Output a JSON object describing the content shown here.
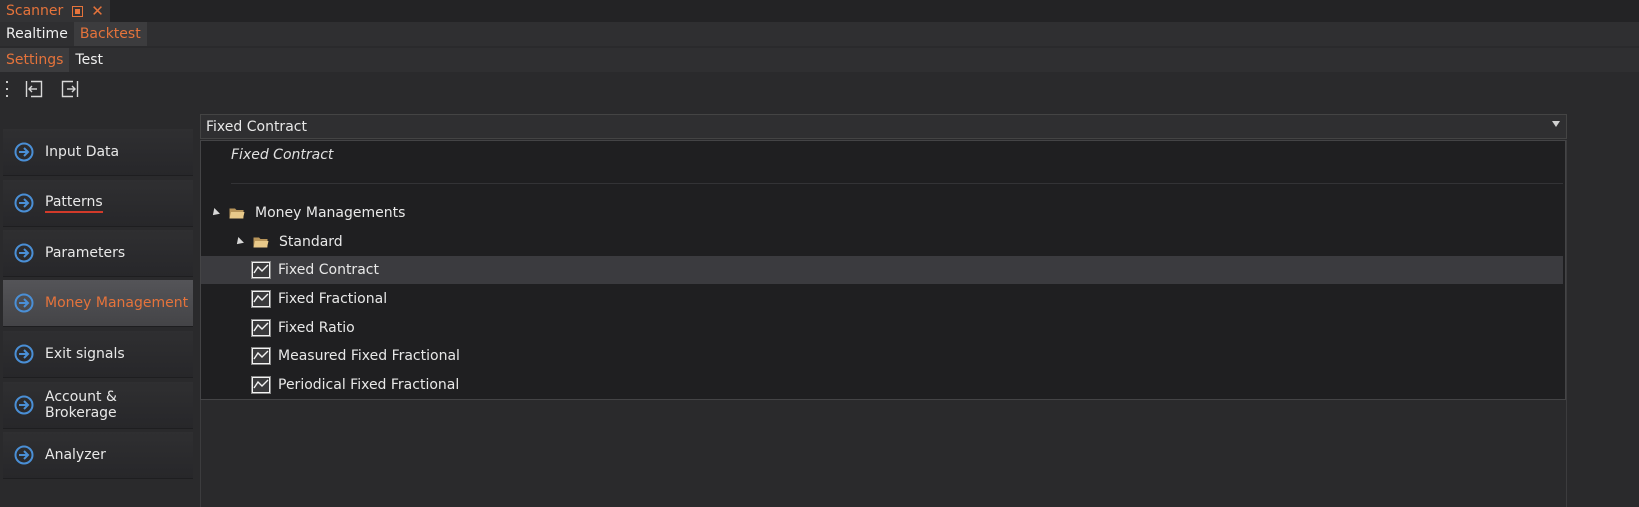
{
  "window": {
    "doc_tab_title": "Scanner",
    "doc_tab_pin_icon": "pin-icon",
    "doc_tab_close_icon": "close-icon"
  },
  "mode_tabs": [
    {
      "label": "Realtime",
      "active": false
    },
    {
      "label": "Backtest",
      "active": true
    }
  ],
  "sub_tabs": [
    {
      "label": "Settings",
      "active": true
    },
    {
      "label": "Test",
      "active": false
    }
  ],
  "toolbar": {
    "import_icon": "import-icon",
    "export_icon": "export-icon"
  },
  "sidebar": {
    "items": [
      {
        "label": "Input Data",
        "icon": "arrow-right-circle-icon",
        "active": false
      },
      {
        "label": "Patterns",
        "icon": "arrow-right-circle-icon",
        "active": false,
        "spellcheck_underline": true
      },
      {
        "label": "Parameters",
        "icon": "arrow-right-circle-icon",
        "active": false
      },
      {
        "label": "Money Management",
        "icon": "arrow-right-circle-icon",
        "active": true
      },
      {
        "label": "Exit signals",
        "icon": "arrow-right-circle-icon",
        "active": false
      },
      {
        "label": "Account & Brokerage",
        "icon": "arrow-right-circle-icon",
        "active": false
      },
      {
        "label": "Analyzer",
        "icon": "arrow-right-circle-icon",
        "active": false
      }
    ]
  },
  "combo": {
    "value": "Fixed Contract"
  },
  "dropdown": {
    "selected_text": "Fixed Contract",
    "tree": {
      "root_label": "Money Managements",
      "group_label": "Standard",
      "items": [
        {
          "label": "Fixed Contract",
          "selected": true
        },
        {
          "label": "Fixed Fractional",
          "selected": false
        },
        {
          "label": "Fixed Ratio",
          "selected": false
        },
        {
          "label": "Measured Fixed Fractional",
          "selected": false
        },
        {
          "label": "Periodical Fixed Fractional",
          "selected": false
        }
      ]
    }
  },
  "colors": {
    "accent": "#e5733b",
    "background": "#2a2a2c",
    "icon_blue": "#4a8fd6",
    "folder_tan": "#e8c98a"
  }
}
